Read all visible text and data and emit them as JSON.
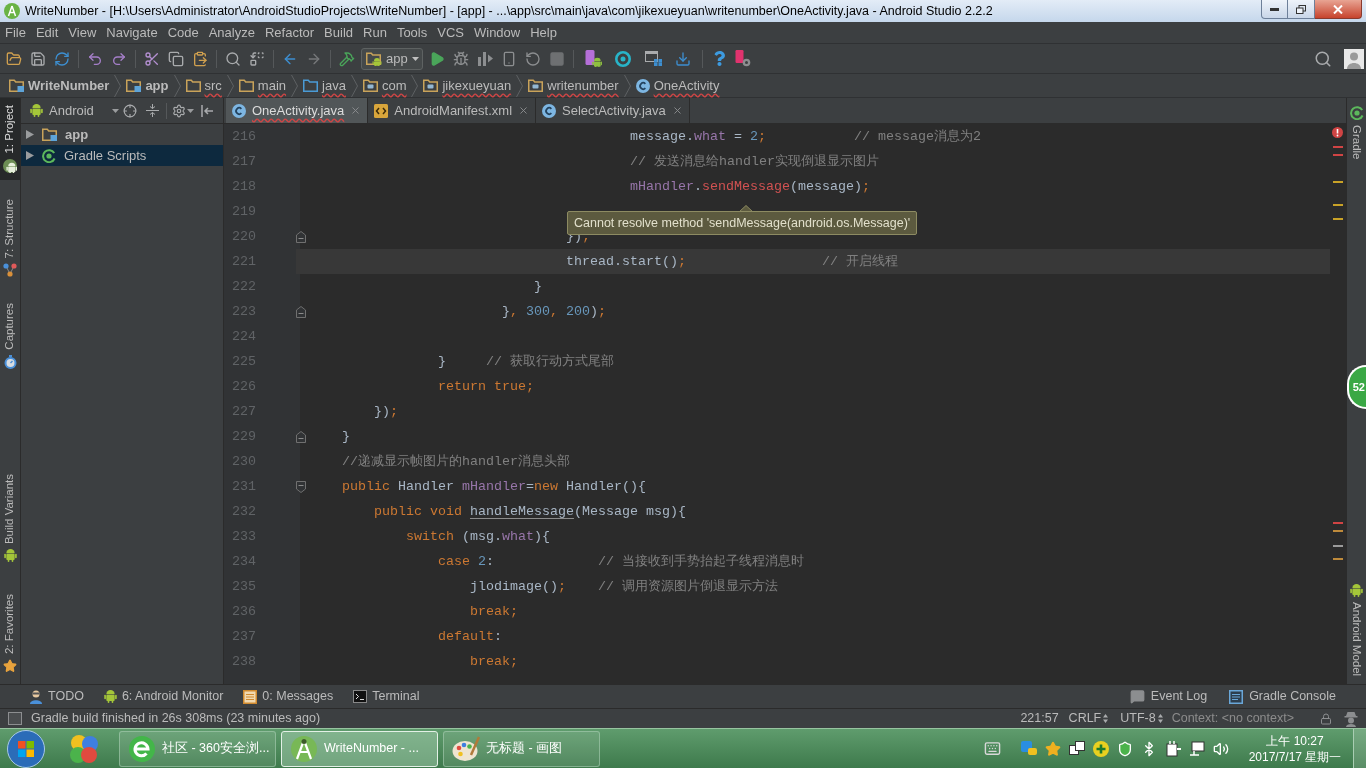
{
  "window": {
    "title": "WriteNumber - [H:\\Users\\Administrator\\AndroidStudioProjects\\WriteNumber] - [app] - ...\\app\\src\\main\\java\\com\\jikexueyuan\\writenumber\\OneActivity.java - Android Studio 2.2.2"
  },
  "menu": [
    "File",
    "Edit",
    "View",
    "Navigate",
    "Code",
    "Analyze",
    "Refactor",
    "Build",
    "Run",
    "Tools",
    "VCS",
    "Window",
    "Help"
  ],
  "toolbar": {
    "run_config": "app"
  },
  "breadcrumbs": [
    {
      "label": "WriteNumber",
      "kind": "module",
      "error": false
    },
    {
      "label": "app",
      "kind": "module",
      "error": false
    },
    {
      "label": "src",
      "kind": "folder",
      "error": true
    },
    {
      "label": "main",
      "kind": "folder",
      "error": true
    },
    {
      "label": "java",
      "kind": "source",
      "error": true
    },
    {
      "label": "com",
      "kind": "package",
      "error": true
    },
    {
      "label": "jikexueyuan",
      "kind": "package",
      "error": true
    },
    {
      "label": "writenumber",
      "kind": "package",
      "error": true
    },
    {
      "label": "OneActivity",
      "kind": "class",
      "error": true
    }
  ],
  "left_tool_tabs": [
    {
      "label": "1: Project",
      "kind": "project",
      "selected": true
    },
    {
      "label": "7: Structure",
      "kind": "structure",
      "selected": false
    },
    {
      "label": "Captures",
      "kind": "captures",
      "selected": false
    },
    {
      "label": "Build Variants",
      "kind": "variants",
      "selected": false
    },
    {
      "label": "2: Favorites",
      "kind": "favorites",
      "selected": false
    }
  ],
  "project_panel": {
    "view": "Android",
    "tree": [
      {
        "label": "app",
        "kind": "module",
        "expanded": false,
        "selected": false
      },
      {
        "label": "Gradle Scripts",
        "kind": "gradle",
        "expanded": false,
        "selected": true
      }
    ]
  },
  "editor_tabs": [
    {
      "label": "OneActivity.java",
      "kind": "class",
      "selected": true,
      "error": true
    },
    {
      "label": "AndroidManifest.xml",
      "kind": "xml",
      "selected": false,
      "error": false
    },
    {
      "label": "SelectActivity.java",
      "kind": "class",
      "selected": false,
      "error": false
    }
  ],
  "code_lines": [
    {
      "number": "216",
      "kind": "plain",
      "current": false,
      "code": [
        {
          "text": "                                        message.",
          "kind": "plain"
        },
        {
          "text": "what",
          "kind": "field"
        },
        {
          "text": " = ",
          "kind": "plain"
        },
        {
          "text": "2",
          "kind": "number"
        },
        {
          "text": ";",
          "kind": "punct"
        }
      ],
      "comment": "           // message消息为2"
    },
    {
      "number": "217",
      "kind": "plain",
      "current": false,
      "comment": "                                        // 发送消息给handler实现倒退显示图片"
    },
    {
      "number": "218",
      "kind": "plain",
      "current": false,
      "code": [
        {
          "text": "                                        mHandler",
          "kind": "field"
        },
        {
          "text": ".",
          "kind": "plain"
        },
        {
          "text": "sendMessage",
          "kind": "error"
        },
        {
          "text": "(message)",
          "kind": "plain"
        },
        {
          "text": ";",
          "kind": "punct"
        }
      ]
    },
    {
      "number": "219",
      "kind": "plain",
      "current": false
    },
    {
      "number": "220",
      "kind": "fold-end",
      "current": false,
      "code": [
        {
          "text": "                                })",
          "kind": "plain"
        },
        {
          "text": ";",
          "kind": "punct"
        }
      ]
    },
    {
      "number": "221",
      "kind": "plain",
      "current": true,
      "code": [
        {
          "text": "                                thread.start()",
          "kind": "plain"
        },
        {
          "text": ";",
          "kind": "punct"
        }
      ],
      "comment": "                 // 开启线程"
    },
    {
      "number": "222",
      "kind": "plain",
      "current": false,
      "code": [
        {
          "text": "                            }",
          "kind": "plain"
        }
      ]
    },
    {
      "number": "223",
      "kind": "fold-end",
      "current": false,
      "code": [
        {
          "text": "                        }",
          "kind": "plain"
        },
        {
          "text": ", ",
          "kind": "punct"
        },
        {
          "text": "300",
          "kind": "number"
        },
        {
          "text": ", ",
          "kind": "punct"
        },
        {
          "text": "200",
          "kind": "number"
        },
        {
          "text": ")",
          "kind": "plain"
        },
        {
          "text": ";",
          "kind": "punct"
        }
      ]
    },
    {
      "number": "224",
      "kind": "plain",
      "current": false
    },
    {
      "number": "225",
      "kind": "plain",
      "current": false,
      "code": [
        {
          "text": "                }",
          "kind": "plain"
        }
      ],
      "comment": "     // 获取行动方式尾部"
    },
    {
      "number": "226",
      "kind": "plain",
      "current": false,
      "code": [
        {
          "text": "                return true",
          "kind": "keyword"
        },
        {
          "text": ";",
          "kind": "punct"
        }
      ]
    },
    {
      "number": "227",
      "kind": "plain",
      "current": false,
      "code": [
        {
          "text": "        })",
          "kind": "plain"
        },
        {
          "text": ";",
          "kind": "punct"
        }
      ]
    },
    {
      "number": "229",
      "kind": "fold-end",
      "current": false,
      "code": [
        {
          "text": "    }",
          "kind": "plain"
        }
      ]
    },
    {
      "number": "230",
      "kind": "plain",
      "current": false,
      "comment": "    //递减显示帧图片的handler消息头部"
    },
    {
      "number": "231",
      "kind": "fold-start",
      "current": false,
      "code": [
        {
          "text": "    public",
          "kind": "keyword"
        },
        {
          "text": " Handler ",
          "kind": "plain"
        },
        {
          "text": "mHandler",
          "kind": "field"
        },
        {
          "text": "=",
          "kind": "plain"
        },
        {
          "text": "new",
          "kind": "keyword"
        },
        {
          "text": " Handler(){",
          "kind": "plain"
        }
      ]
    },
    {
      "number": "232",
      "kind": "plain",
      "current": false,
      "code": [
        {
          "text": "        public void ",
          "kind": "keyword"
        },
        {
          "text": "handleMessage",
          "kind": "warning"
        },
        {
          "text": "(Message msg){",
          "kind": "plain"
        }
      ]
    },
    {
      "number": "233",
      "kind": "plain",
      "current": false,
      "code": [
        {
          "text": "            switch",
          "kind": "keyword"
        },
        {
          "text": " (msg.",
          "kind": "plain"
        },
        {
          "text": "what",
          "kind": "field"
        },
        {
          "text": "){",
          "kind": "plain"
        }
      ]
    },
    {
      "number": "234",
      "kind": "plain",
      "current": false,
      "code": [
        {
          "text": "                case ",
          "kind": "keyword"
        },
        {
          "text": "2",
          "kind": "number"
        },
        {
          "text": ":",
          "kind": "plain"
        }
      ],
      "comment": "             // 当接收到手势抬起子线程消息时"
    },
    {
      "number": "235",
      "kind": "plain",
      "current": false,
      "code": [
        {
          "text": "                    jlodimage()",
          "kind": "plain"
        },
        {
          "text": ";",
          "kind": "punct"
        }
      ],
      "comment": "    // 调用资源图片倒退显示方法"
    },
    {
      "number": "236",
      "kind": "plain",
      "current": false,
      "code": [
        {
          "text": "                    break",
          "kind": "keyword"
        },
        {
          "text": ";",
          "kind": "punct"
        }
      ]
    },
    {
      "number": "237",
      "kind": "plain",
      "current": false,
      "code": [
        {
          "text": "                default",
          "kind": "keyword"
        },
        {
          "text": ":",
          "kind": "plain"
        }
      ]
    },
    {
      "number": "238",
      "kind": "plain",
      "current": false,
      "code": [
        {
          "text": "                    break",
          "kind": "keyword"
        },
        {
          "text": ";",
          "kind": "punct"
        }
      ]
    }
  ],
  "tooltip": {
    "text": "Cannot resolve method 'sendMessage(android.os.Message)'"
  },
  "right_tool_tabs": [
    {
      "label": "Gradle",
      "kind": "gradle"
    },
    {
      "label": "Android Model",
      "kind": "model"
    }
  ],
  "floating_ball": {
    "text": "52"
  },
  "bottom_tool_tabs": {
    "left": [
      {
        "label": "TODO",
        "kind": "todo"
      },
      {
        "label": "6: Android Monitor",
        "kind": "monitor"
      },
      {
        "label": "0: Messages",
        "kind": "messages"
      },
      {
        "label": "Terminal",
        "kind": "terminal"
      }
    ],
    "right": [
      {
        "label": "Event Log",
        "kind": "events"
      },
      {
        "label": "Gradle Console",
        "kind": "console"
      }
    ]
  },
  "status_bar": {
    "message": "Gradle build finished in 26s 308ms (23 minutes ago)",
    "position": "221:57",
    "line_separator": "CRLF",
    "encoding": "UTF-8",
    "context": "Context: <no context>"
  },
  "taskbar": {
    "buttons": [
      {
        "label": "社区 - 360安全浏...",
        "kind": "browser",
        "selected": false
      },
      {
        "label": "WriteNumber - ...",
        "kind": "studio",
        "selected": true
      },
      {
        "label": "无标题 - 画图",
        "kind": "paint",
        "selected": false
      }
    ],
    "clock": {
      "time": "上午 10:27",
      "date": "2017/7/17 星期一"
    }
  }
}
